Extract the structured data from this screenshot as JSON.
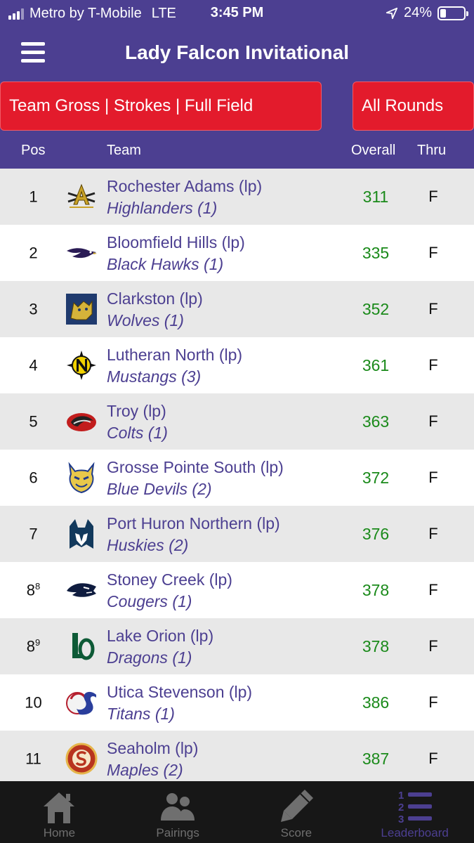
{
  "status": {
    "carrier": "Metro by T-Mobile",
    "network": "LTE",
    "time": "3:45 PM",
    "battery": "24%",
    "battery_level": 0.24
  },
  "header": {
    "title": "Lady Falcon Invitational"
  },
  "filters": {
    "type": "Team Gross | Strokes | Full Field",
    "rounds": "All Rounds"
  },
  "columns": {
    "pos": "Pos",
    "team": "Team",
    "overall": "Overall",
    "thru": "Thru"
  },
  "rows": [
    {
      "pos": "1",
      "sup": "",
      "team": "Rochester Adams (lp)",
      "mascot": "Highlanders (1)",
      "overall": "311",
      "thru": "F",
      "logo": "rochester-adams-logo-icon"
    },
    {
      "pos": "2",
      "sup": "",
      "team": "Bloomfield Hills (lp)",
      "mascot": "Black Hawks (1)",
      "overall": "335",
      "thru": "F",
      "logo": "black-hawk-logo-icon"
    },
    {
      "pos": "3",
      "sup": "",
      "team": "Clarkston (lp)",
      "mascot": "Wolves (1)",
      "overall": "352",
      "thru": "F",
      "logo": "wolves-logo-icon"
    },
    {
      "pos": "4",
      "sup": "",
      "team": "Lutheran North (lp)",
      "mascot": "Mustangs (3)",
      "overall": "361",
      "thru": "F",
      "logo": "lutheran-north-logo-icon"
    },
    {
      "pos": "5",
      "sup": "",
      "team": "Troy (lp)",
      "mascot": "Colts (1)",
      "overall": "363",
      "thru": "F",
      "logo": "colts-logo-icon"
    },
    {
      "pos": "6",
      "sup": "",
      "team": "Grosse Pointe South (lp)",
      "mascot": "Blue Devils (2)",
      "overall": "372",
      "thru": "F",
      "logo": "blue-devil-logo-icon"
    },
    {
      "pos": "7",
      "sup": "",
      "team": "Port Huron Northern (lp)",
      "mascot": "Huskies (2)",
      "overall": "376",
      "thru": "F",
      "logo": "husky-logo-icon"
    },
    {
      "pos": "8",
      "sup": "8",
      "team": "Stoney Creek (lp)",
      "mascot": "Cougers (1)",
      "overall": "378",
      "thru": "F",
      "logo": "cougar-logo-icon"
    },
    {
      "pos": "8",
      "sup": "9",
      "team": "Lake Orion (lp)",
      "mascot": "Dragons (1)",
      "overall": "378",
      "thru": "F",
      "logo": "lake-orion-logo-icon"
    },
    {
      "pos": "10",
      "sup": "",
      "team": "Utica Stevenson (lp)",
      "mascot": "Titans (1)",
      "overall": "386",
      "thru": "F",
      "logo": "titans-logo-icon"
    },
    {
      "pos": "11",
      "sup": "",
      "team": "Seaholm (lp)",
      "mascot": "Maples (2)",
      "overall": "387",
      "thru": "F",
      "logo": "seaholm-logo-icon"
    }
  ],
  "tabs": [
    {
      "label": "Home",
      "icon": "home-icon",
      "active": false
    },
    {
      "label": "Pairings",
      "icon": "pairings-icon",
      "active": false
    },
    {
      "label": "Score",
      "icon": "pencil-icon",
      "active": false
    },
    {
      "label": "Leaderboard",
      "icon": "leaderboard-icon",
      "active": true
    }
  ],
  "colors": {
    "brand_purple": "#4c3f91",
    "filter_red": "#e31b2c",
    "score_green": "#1a8a1a",
    "row_alt": "#e8e8e8",
    "tab_bar": "#171717"
  }
}
